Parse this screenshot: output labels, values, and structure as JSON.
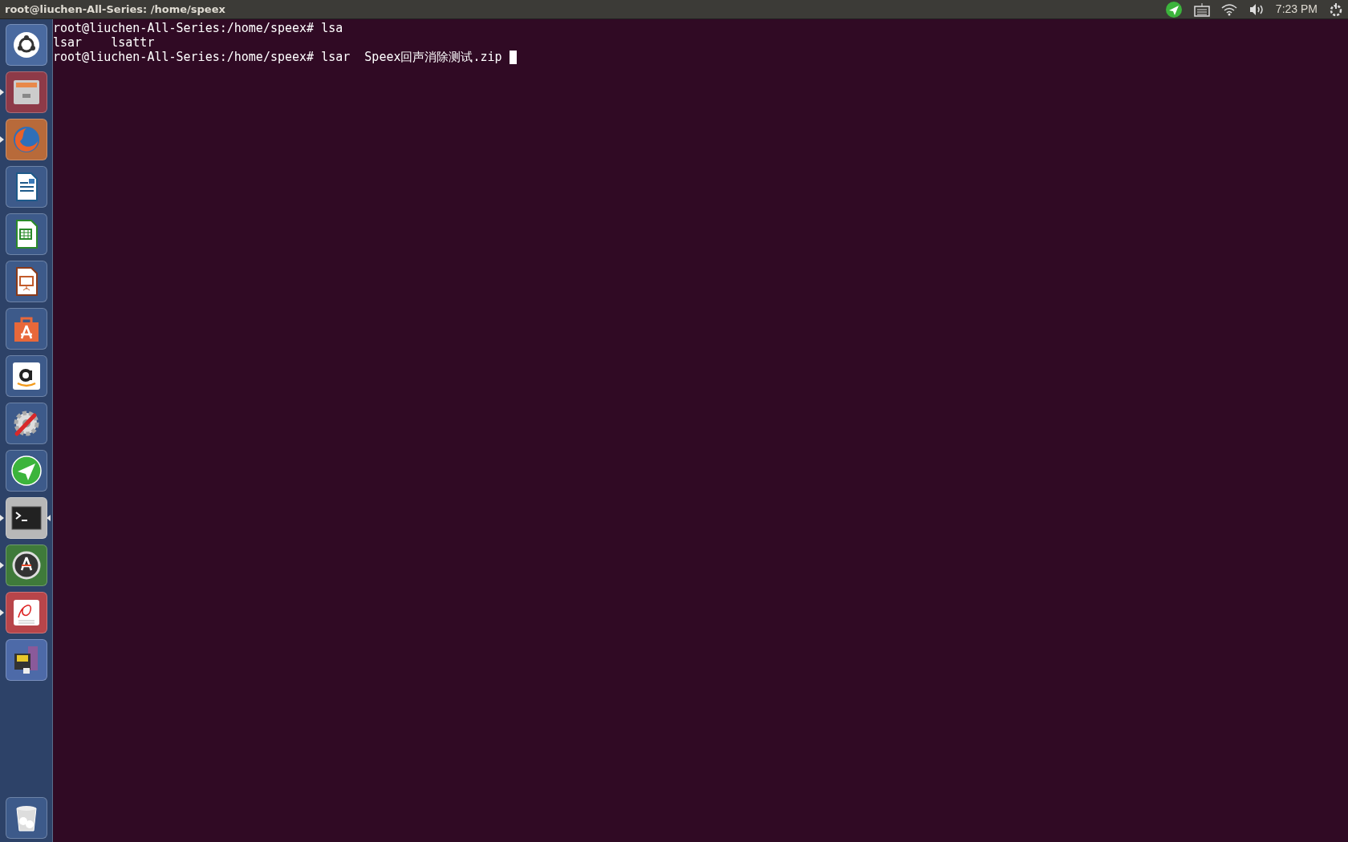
{
  "top_bar": {
    "title": "root@liuchen-All-Series: /home/speex",
    "clock": "7:23 PM"
  },
  "launcher": {
    "items": [
      {
        "kind": "dash",
        "running": false,
        "focused": false
      },
      {
        "kind": "files",
        "running": true,
        "focused": false
      },
      {
        "kind": "browser",
        "running": true,
        "focused": false
      },
      {
        "kind": "writer",
        "running": false,
        "focused": false
      },
      {
        "kind": "calc",
        "running": false,
        "focused": false
      },
      {
        "kind": "impress",
        "running": false,
        "focused": false
      },
      {
        "kind": "store",
        "running": false,
        "focused": false
      },
      {
        "kind": "amazon",
        "running": false,
        "focused": false
      },
      {
        "kind": "settings",
        "running": false,
        "focused": false
      },
      {
        "kind": "send",
        "running": false,
        "focused": false
      },
      {
        "kind": "terminal",
        "running": true,
        "focused": true
      },
      {
        "kind": "updater",
        "running": true,
        "focused": false
      },
      {
        "kind": "reader",
        "running": true,
        "focused": false
      },
      {
        "kind": "usb",
        "running": false,
        "focused": false
      }
    ],
    "trash": {
      "kind": "trash"
    }
  },
  "terminal": {
    "lines": [
      "root@liuchen-All-Series:/home/speex# lsa",
      "lsar    lsattr",
      "root@liuchen-All-Series:/home/speex# lsar  Speex回声消除测试.zip "
    ],
    "cursor": true
  }
}
